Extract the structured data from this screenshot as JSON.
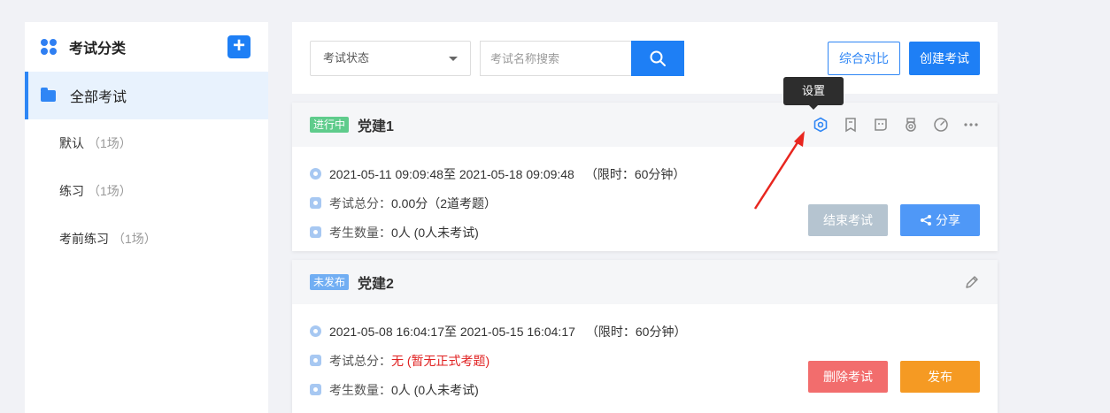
{
  "sidebar": {
    "title": "考试分类",
    "add_label": "+",
    "all_label": "全部考试",
    "items": [
      {
        "label": "默认",
        "count": "（1场）"
      },
      {
        "label": "练习",
        "count": "（1场）"
      },
      {
        "label": "考前练习",
        "count": "（1场）"
      }
    ]
  },
  "toolbar": {
    "status_select": "考试状态",
    "search_placeholder": "考试名称搜索",
    "compare_label": "综合对比",
    "create_label": "创建考试"
  },
  "tooltip": "设置",
  "exams": [
    {
      "status": "进行中",
      "title": "党建1",
      "time": "2021-05-11 09:09:48至 2021-05-18 09:09:48",
      "limit": "（限时：60分钟）",
      "score_label": "考试总分：",
      "score_value": "0.00分（2道考题）",
      "count_label": "考生数量：",
      "count_value": "0人 (0人未考试)",
      "btn_primary": "结束考试",
      "btn_secondary": "分享"
    },
    {
      "status": "未发布",
      "title": "党建2",
      "time": "2021-05-08 16:04:17至 2021-05-15 16:04:17",
      "limit": "（限时：60分钟）",
      "score_label": "考试总分：",
      "score_value": "无 (暂无正式考题)",
      "count_label": "考生数量：",
      "count_value": "0人 (0人未考试)",
      "btn_primary": "删除考试",
      "btn_secondary": "发布"
    }
  ],
  "colors": {
    "primary": "#1e7ff5",
    "running": "#5fcc8c",
    "unpublished": "#71aef3",
    "danger": "#f26d6d",
    "warning": "#f59a23",
    "disabled": "#b5c4d0",
    "annotation": "#e8261f"
  },
  "icons": [
    "settings-icon",
    "bookmark-icon",
    "comment-icon",
    "medal-icon",
    "timer-icon",
    "more-icon",
    "edit-icon",
    "search-icon",
    "share-icon"
  ]
}
